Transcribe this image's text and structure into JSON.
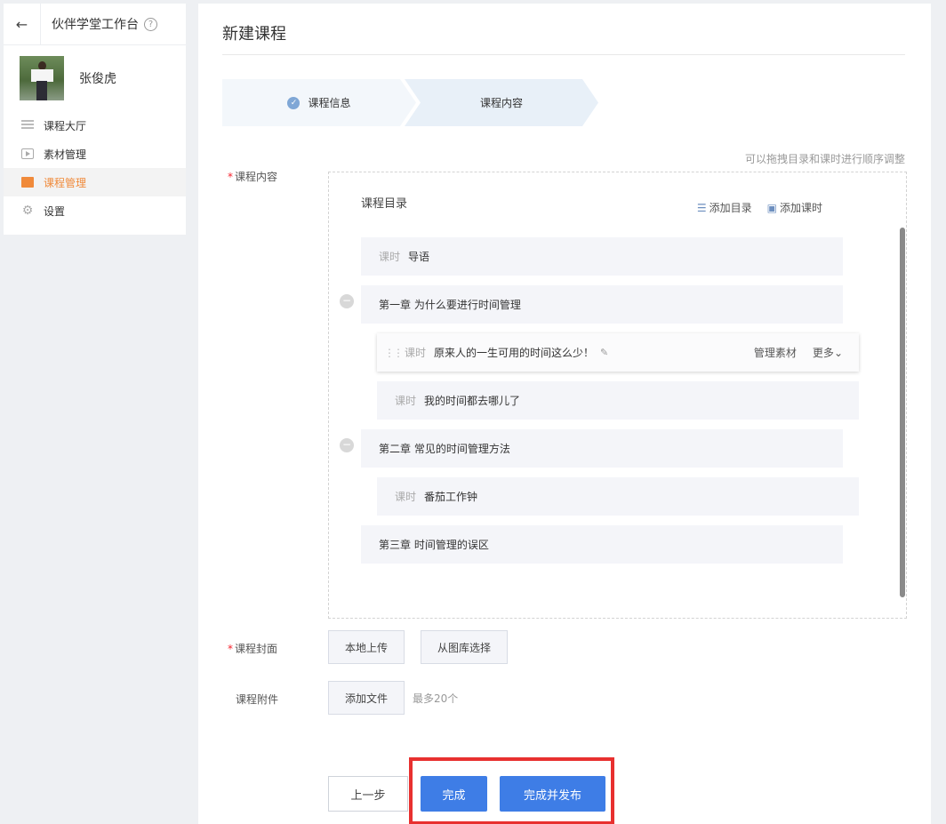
{
  "sidebar": {
    "back_icon": "←",
    "title": "伙伴学堂工作台",
    "help_icon": "?",
    "user_name": "张俊虎",
    "menu": [
      {
        "label": "课程大厅",
        "icon": "list-icon"
      },
      {
        "label": "素材管理",
        "icon": "media-icon"
      },
      {
        "label": "课程管理",
        "icon": "book-icon",
        "active": true
      },
      {
        "label": "设置",
        "icon": "gear-icon"
      }
    ],
    "accent_color": "#f08a3a"
  },
  "main": {
    "title": "新建课程",
    "steps": [
      {
        "label": "课程信息",
        "done": true
      },
      {
        "label": "课程内容"
      }
    ],
    "hint": "可以拖拽目录和课时进行顺序调整",
    "content_label": "课程内容",
    "catalog": {
      "title": "课程目录",
      "add_catalog": "添加目录",
      "add_lesson": "添加课时",
      "rows": [
        {
          "type": "lesson",
          "tag": "课时",
          "text": "导语"
        },
        {
          "type": "chapter",
          "text": "第一章 为什么要进行时间管理",
          "collapse_icon": "−"
        },
        {
          "type": "sub",
          "tag": "课时",
          "text": "原来人的一生可用的时间这么少！",
          "active": true,
          "action_manage": "管理素材",
          "action_more": "更多"
        },
        {
          "type": "sub",
          "tag": "课时",
          "text": "我的时间都去哪儿了"
        },
        {
          "type": "chapter",
          "text": "第二章 常见的时间管理方法",
          "collapse_icon": "−"
        },
        {
          "type": "sub",
          "tag": "课时",
          "text": "番茄工作钟"
        },
        {
          "type": "chapter",
          "text": "第三章 时间管理的误区"
        }
      ]
    },
    "cover_label": "课程封面",
    "cover_local": "本地上传",
    "cover_gallery": "从图库选择",
    "attach_label": "课程附件",
    "attach_add": "添加文件",
    "attach_note": "最多20个",
    "btn_prev": "上一步",
    "btn_done": "完成",
    "btn_publish": "完成并发布",
    "primary_color": "#3e7de6",
    "highlight_color": "#e8302f"
  }
}
